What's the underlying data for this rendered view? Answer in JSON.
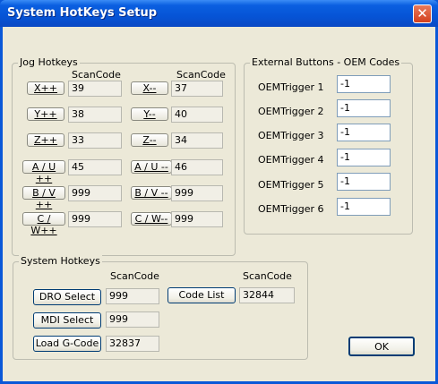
{
  "window": {
    "title": "System HotKeys Setup",
    "close_glyph": "✕"
  },
  "jog": {
    "title": "Jog Hotkeys",
    "scancode_header_left": "ScanCode",
    "scancode_header_right": "ScanCode",
    "rows": [
      {
        "left_label": "X++",
        "left_code": "39",
        "right_label": "X--",
        "right_code": "37"
      },
      {
        "left_label": "Y++",
        "left_code": "38",
        "right_label": "Y--",
        "right_code": "40"
      },
      {
        "left_label": "Z++",
        "left_code": "33",
        "right_label": "Z--",
        "right_code": "34"
      },
      {
        "left_label": "A / U ++",
        "left_code": "45",
        "right_label": "A / U --",
        "right_code": "46"
      },
      {
        "left_label": "B / V ++",
        "left_code": "999",
        "right_label": "B / V --",
        "right_code": "999"
      },
      {
        "left_label": "C / W++",
        "left_code": "999",
        "right_label": "C / W--",
        "right_code": "999"
      }
    ]
  },
  "oem": {
    "title": "External Buttons - OEM Codes",
    "triggers": [
      {
        "label": "OEMTrigger 1",
        "value": "-1"
      },
      {
        "label": "OEMTrigger 2",
        "value": "-1"
      },
      {
        "label": "OEMTrigger 3",
        "value": "-1"
      },
      {
        "label": "OEMTrigger 4",
        "value": "-1"
      },
      {
        "label": "OEMTrigger 5",
        "value": "-1"
      },
      {
        "label": "OEMTrigger 6",
        "value": "-1"
      }
    ]
  },
  "system": {
    "title": "System Hotkeys",
    "scancode_header_left": "ScanCode",
    "scancode_header_right": "ScanCode",
    "dro_select": {
      "label": "DRO Select",
      "code": "999"
    },
    "mdi_select": {
      "label": "MDI Select",
      "code": "999"
    },
    "load_gcode": {
      "label": "Load G-Code",
      "code": "32837"
    },
    "code_list": {
      "label": "Code List",
      "code": "32844"
    }
  },
  "ok_label": "OK"
}
